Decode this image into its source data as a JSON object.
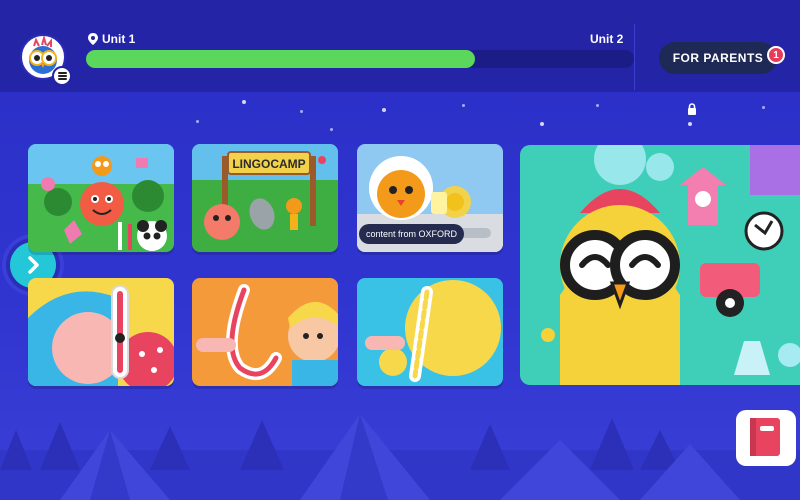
{
  "header": {
    "unit_current": "Unit 1",
    "unit_next": "Unit 2",
    "progress": 0.71,
    "parents_button": "FOR PARENTS",
    "notification_count": "1"
  },
  "cards": [
    {
      "name": "lesson-card-characters"
    },
    {
      "name": "lesson-card-lingocamp",
      "sign": "LINGOCAMP"
    },
    {
      "name": "lesson-card-oxford",
      "tag": "content from OXFORD"
    },
    {
      "name": "lesson-card-trace-i"
    },
    {
      "name": "lesson-card-trace-l"
    },
    {
      "name": "lesson-card-trace-slash"
    }
  ],
  "colors": {
    "background": "#2b2fc4",
    "header": "#2324a6",
    "progress_fill": "#5bd85b",
    "next_button": "#23c7d8",
    "badge": "#e93a5a"
  },
  "icons": [
    "map-pin-icon",
    "lock-icon",
    "menu-icon",
    "chevron-right-icon",
    "book-icon"
  ]
}
